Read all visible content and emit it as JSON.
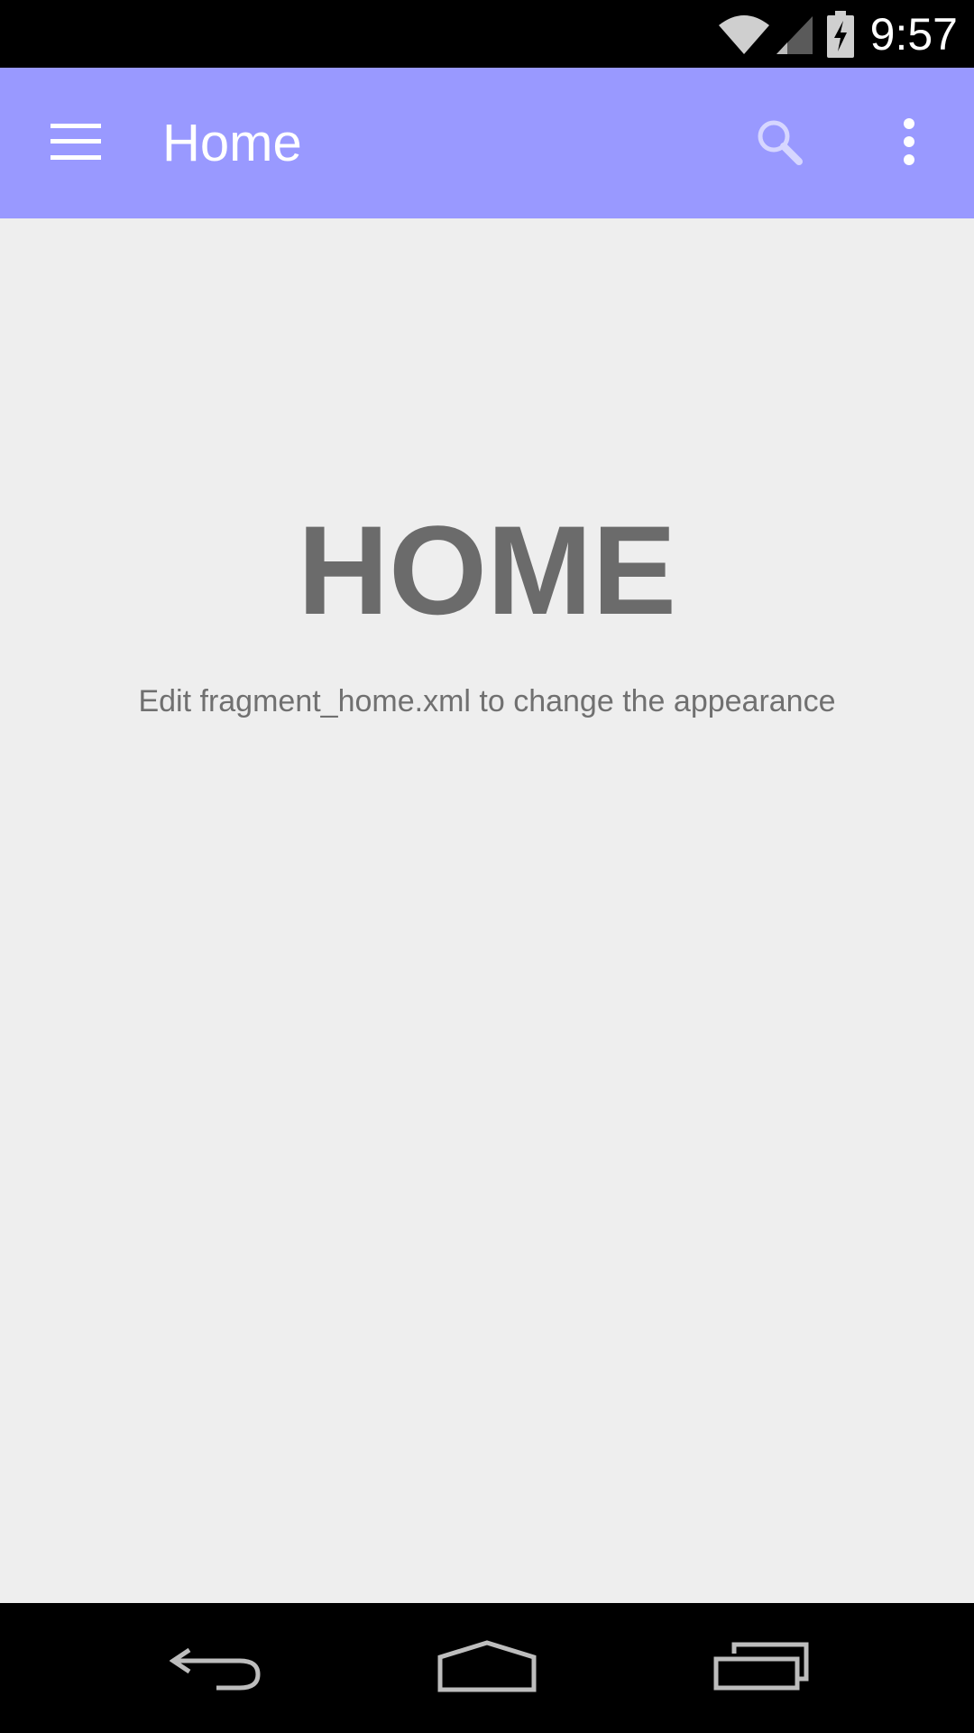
{
  "status_bar": {
    "time": "9:57",
    "icons": [
      "wifi-icon",
      "cellular-signal-icon",
      "battery-charging-icon"
    ]
  },
  "app_bar": {
    "title": "Home",
    "background_color": "#9999ff",
    "icons": {
      "menu": "hamburger-menu-icon",
      "search": "search-icon",
      "overflow": "overflow-menu-icon"
    }
  },
  "main": {
    "heading": "HOME",
    "subtitle": "Edit fragment_home.xml to change the appearance"
  },
  "nav_bar": {
    "icons": [
      "back-icon",
      "home-icon",
      "recent-apps-icon"
    ]
  }
}
